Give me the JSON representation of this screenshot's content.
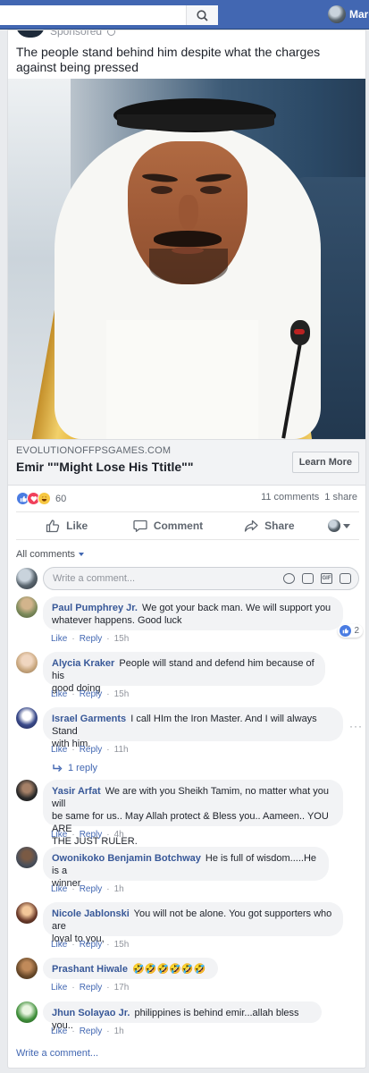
{
  "topbar": {
    "user_name": "Marc"
  },
  "post": {
    "sponsored_label": "Sponsored",
    "text": "The people stand behind him despite what the charges against being pressed",
    "link_domain": "EVOLUTIONOFFPSGAMES.COM",
    "link_title": "Emir \"\"Might Lose His Ttitle\"\"",
    "learn_more": "Learn More",
    "reaction_count": "60",
    "comments_count": "11 comments",
    "shares_count": "1 share"
  },
  "actions": {
    "like": "Like",
    "comment": "Comment",
    "share": "Share"
  },
  "comments_header": "All comments",
  "composer_placeholder": "Write a comment...",
  "comment_actions": {
    "like": "Like",
    "reply": "Reply",
    "separator": "·"
  },
  "comments": [
    {
      "author": "Paul Pumphrey Jr.",
      "text_1": "We got your back man. We will support you",
      "text_2": "whatever happens. Good luck",
      "time": "15h",
      "likes": "2"
    },
    {
      "author": "Alycia Kraker",
      "text_1": "People will stand and defend him because of his",
      "text_2": "good doing",
      "time": "15h"
    },
    {
      "author": "Israel Garments",
      "text_1": "I call HIm the Iron Master. And I will always Stand",
      "text_2": "with him.",
      "time": "11h",
      "replies": "1 reply"
    },
    {
      "author": "Yasir Arfat",
      "text_1": "We are with you Sheikh Tamim, no matter what you will",
      "text_2": "be same for us.. May Allah protect & Bless you.. Aameen.. YOU ARE",
      "text_3": "THE JUST RULER.",
      "time": "4h"
    },
    {
      "author": "Owonikoko Benjamin Botchway",
      "text_1": "He is full of wisdom.....He is a",
      "text_2": "winner",
      "time": "1h"
    },
    {
      "author": "Nicole Jablonski",
      "text_1": "You will not be alone. You got supporters who are",
      "text_2": "loyal to you,",
      "time": "15h"
    },
    {
      "author": "Prashant Hiwale",
      "text_1": "🤣🤣🤣🤣🤣🤣",
      "time": "17h"
    },
    {
      "author": "Jhun Solayao Jr.",
      "text_1": "philippines is behind emir...allah bless you..",
      "time": "1h"
    }
  ],
  "write_comment": "Write a comment...",
  "colors": {
    "facebook_blue": "#4267b2",
    "link_blue": "#385898",
    "bubble_gray": "#f2f3f5"
  }
}
